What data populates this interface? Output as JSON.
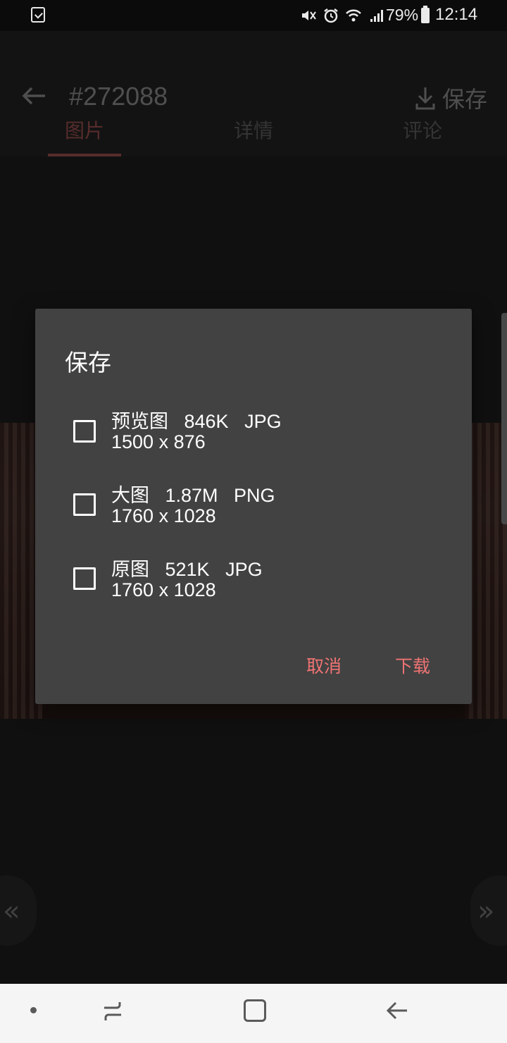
{
  "status_bar": {
    "battery_percent": "79%",
    "time": "12:14",
    "icons": [
      "task-check-icon",
      "mute-icon",
      "alarm-icon",
      "wifi-icon",
      "signal-4g-icon",
      "battery-icon"
    ]
  },
  "app_bar": {
    "title": "#272088",
    "save_label": "保存"
  },
  "tabs": [
    {
      "label": "图片",
      "active": true
    },
    {
      "label": "详情",
      "active": false
    },
    {
      "label": "评论",
      "active": false
    }
  ],
  "dialog": {
    "title": "保存",
    "options": [
      {
        "line1": "预览图   846K   JPG",
        "line2": "1500 x 876",
        "checked": false
      },
      {
        "line1": "大图   1.87M   PNG",
        "line2": "1760 x 1028",
        "checked": false
      },
      {
        "line1": "原图   521K   JPG",
        "line2": "1760 x 1028",
        "checked": false
      }
    ],
    "cancel_label": "取消",
    "confirm_label": "下载"
  },
  "nav_arrows": {
    "prev": "«",
    "next": "»"
  },
  "colors": {
    "accent": "#e57373",
    "dialog_bg": "#424242",
    "button_text": "#ef7373"
  }
}
